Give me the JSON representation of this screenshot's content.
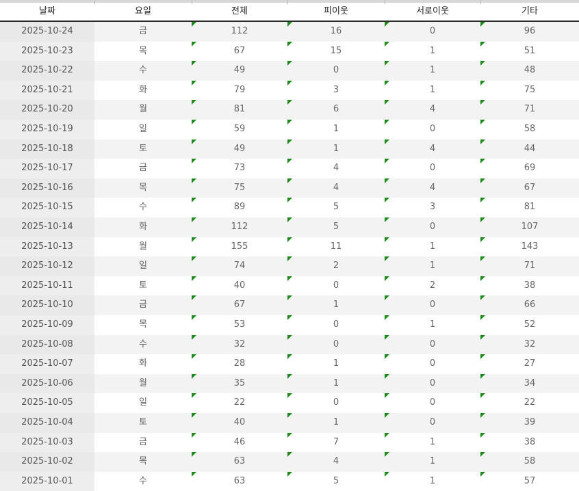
{
  "headers": [
    "날짜",
    "요일",
    "전체",
    "피이웃",
    "서로이웃",
    "기타"
  ],
  "rows": [
    [
      "2025-10-24",
      "금",
      "112",
      "16",
      "0",
      "96"
    ],
    [
      "2025-10-23",
      "목",
      "67",
      "15",
      "1",
      "51"
    ],
    [
      "2025-10-22",
      "수",
      "49",
      "0",
      "1",
      "48"
    ],
    [
      "2025-10-21",
      "화",
      "79",
      "3",
      "1",
      "75"
    ],
    [
      "2025-10-20",
      "월",
      "81",
      "6",
      "4",
      "71"
    ],
    [
      "2025-10-19",
      "일",
      "59",
      "1",
      "0",
      "58"
    ],
    [
      "2025-10-18",
      "토",
      "49",
      "1",
      "4",
      "44"
    ],
    [
      "2025-10-17",
      "금",
      "73",
      "4",
      "0",
      "69"
    ],
    [
      "2025-10-16",
      "목",
      "75",
      "4",
      "4",
      "67"
    ],
    [
      "2025-10-15",
      "수",
      "89",
      "5",
      "3",
      "81"
    ],
    [
      "2025-10-14",
      "화",
      "112",
      "5",
      "0",
      "107"
    ],
    [
      "2025-10-13",
      "월",
      "155",
      "11",
      "1",
      "143"
    ],
    [
      "2025-10-12",
      "일",
      "74",
      "2",
      "1",
      "71"
    ],
    [
      "2025-10-11",
      "토",
      "40",
      "0",
      "2",
      "38"
    ],
    [
      "2025-10-10",
      "금",
      "67",
      "1",
      "0",
      "66"
    ],
    [
      "2025-10-09",
      "목",
      "53",
      "0",
      "1",
      "52"
    ],
    [
      "2025-10-08",
      "수",
      "32",
      "0",
      "0",
      "32"
    ],
    [
      "2025-10-07",
      "화",
      "28",
      "1",
      "0",
      "27"
    ],
    [
      "2025-10-06",
      "월",
      "35",
      "1",
      "0",
      "34"
    ],
    [
      "2025-10-05",
      "일",
      "22",
      "0",
      "0",
      "22"
    ],
    [
      "2025-10-04",
      "토",
      "40",
      "1",
      "0",
      "39"
    ],
    [
      "2025-10-03",
      "금",
      "46",
      "7",
      "1",
      "38"
    ],
    [
      "2025-10-02",
      "목",
      "63",
      "4",
      "1",
      "58"
    ],
    [
      "2025-10-01",
      "수",
      "63",
      "5",
      "1",
      "57"
    ]
  ],
  "colors": {
    "header_rule": "#2b2b2b",
    "stripe": "#f3f3f3",
    "date_cell": "#e9e9e9",
    "comment_marker": "#1e8a1e"
  }
}
